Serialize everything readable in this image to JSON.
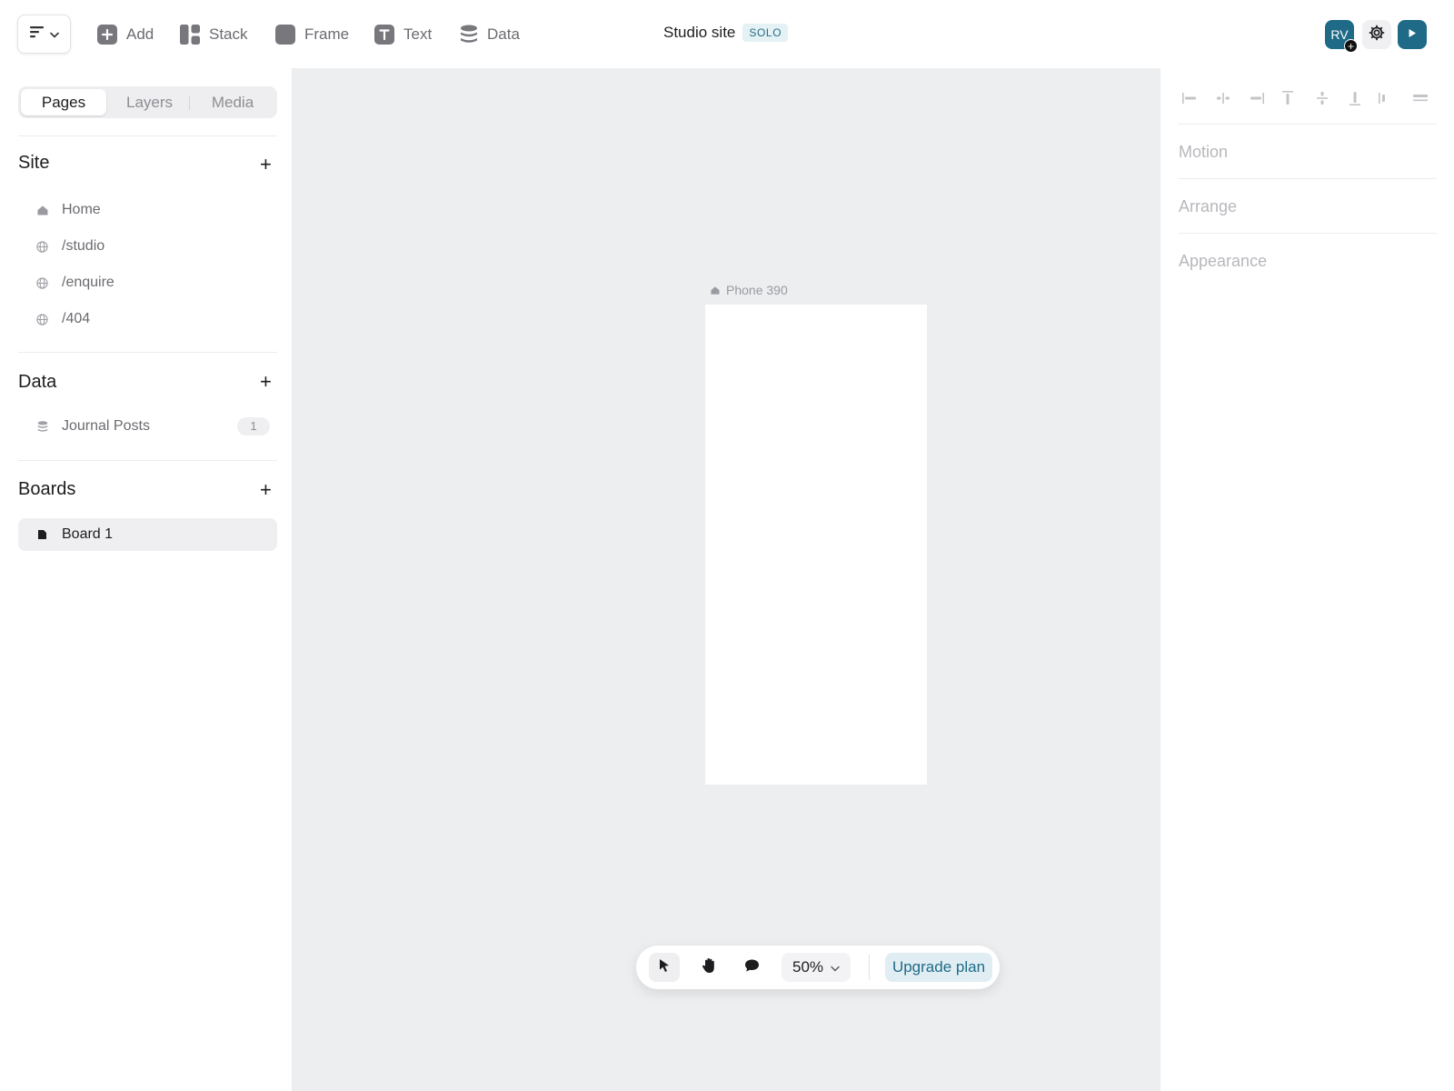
{
  "topbar": {
    "tools": [
      {
        "label": "Add",
        "icon": "plus-square-icon"
      },
      {
        "label": "Stack",
        "icon": "stack-icon"
      },
      {
        "label": "Frame",
        "icon": "frame-icon"
      },
      {
        "label": "Text",
        "icon": "text-icon"
      },
      {
        "label": "Data",
        "icon": "database-icon"
      }
    ],
    "site_title": "Studio site",
    "plan_badge": "SOLO",
    "avatar_initials": "RV",
    "avatar_plus": "+"
  },
  "sidebar": {
    "tabs": [
      {
        "label": "Pages",
        "active": true
      },
      {
        "label": "Layers",
        "active": false
      },
      {
        "label": "Media",
        "active": false
      }
    ],
    "site": {
      "title": "Site",
      "add_label": "+",
      "pages": [
        {
          "label": "Home",
          "icon": "home-icon"
        },
        {
          "label": "/studio",
          "icon": "globe-icon"
        },
        {
          "label": "/enquire",
          "icon": "globe-icon"
        },
        {
          "label": "/404",
          "icon": "globe-icon"
        }
      ]
    },
    "data": {
      "title": "Data",
      "add_label": "+",
      "collections": [
        {
          "label": "Journal Posts",
          "count": "1",
          "icon": "database-icon"
        }
      ]
    },
    "boards": {
      "title": "Boards",
      "add_label": "+",
      "items": [
        {
          "label": "Board 1",
          "icon": "board-icon",
          "active": true
        }
      ]
    }
  },
  "canvas": {
    "frame_label": "Phone 390",
    "zoom": "50%",
    "upgrade_label": "Upgrade plan"
  },
  "right_panel": {
    "sections": [
      "Motion",
      "Arrange",
      "Appearance"
    ]
  },
  "colors": {
    "accent": "#1e6a87",
    "canvas_bg": "#eceef0",
    "muted_text": "#6b6b70"
  }
}
